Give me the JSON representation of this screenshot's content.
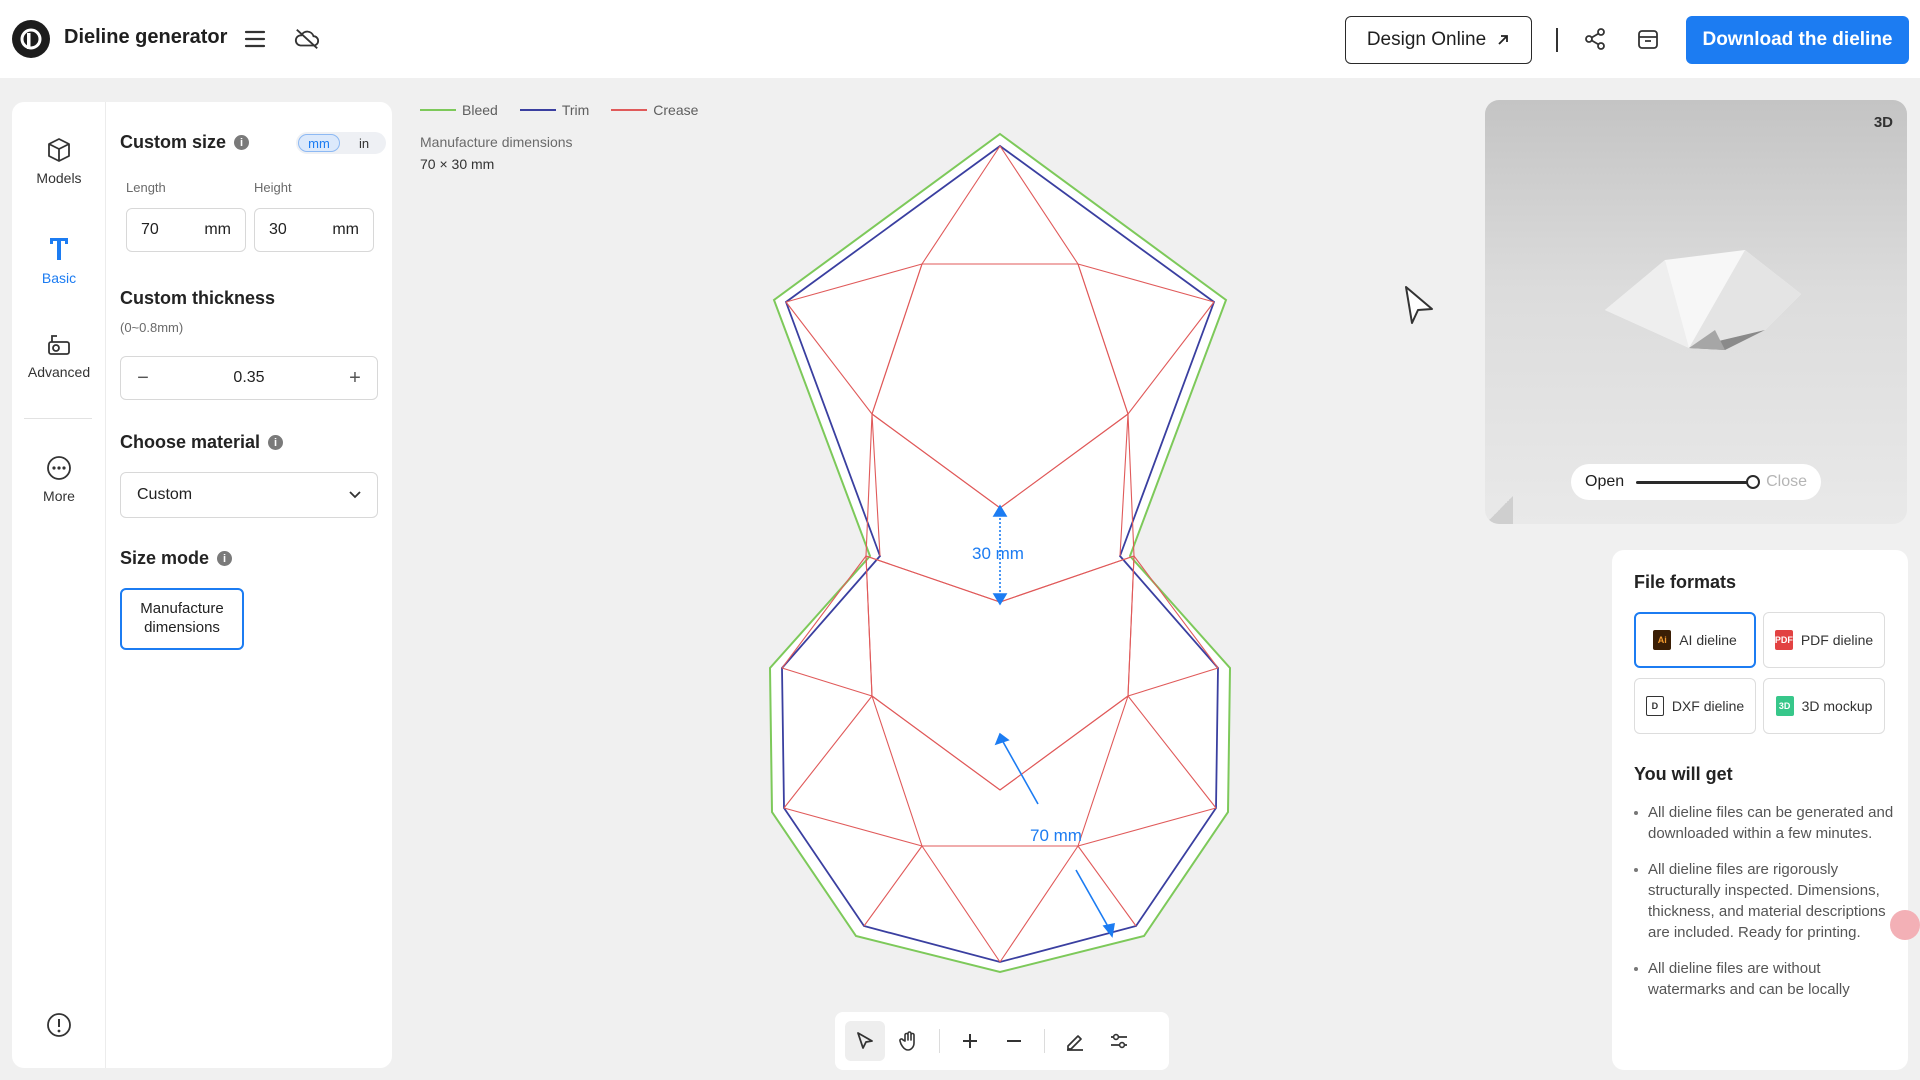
{
  "header": {
    "app_title": "Dieline generator",
    "icons": [
      "menu-icon",
      "cloud-off-icon",
      "share-icon",
      "archive-icon"
    ],
    "design_online_label": "Design Online",
    "download_label": "Download the dieline",
    "accent_color": "#1c7cf2"
  },
  "rail": {
    "items": [
      {
        "label": "Models",
        "icon": "cube-icon"
      },
      {
        "label": "Basic",
        "icon": "text-t-icon",
        "active": true
      },
      {
        "label": "Advanced",
        "icon": "advanced-icon"
      },
      {
        "label": "More",
        "icon": "more-icon"
      }
    ],
    "footer_icon": "info-circle-icon"
  },
  "form": {
    "custom_size_title": "Custom size",
    "units": [
      "mm",
      "in"
    ],
    "active_unit": "mm",
    "length_label": "Length",
    "height_label": "Height",
    "length_value": "70",
    "height_value": "30",
    "unit_suffix": "mm",
    "thickness_title": "Custom thickness",
    "thickness_range": "(0~0.8mm)",
    "thickness_value": "0.35",
    "material_title": "Choose material",
    "material_value": "Custom",
    "size_mode_title": "Size mode",
    "size_mode_value": "Manufacture dimensions"
  },
  "canvas": {
    "legend": [
      {
        "label": "Bleed",
        "color": "#7dc95a"
      },
      {
        "label": "Trim",
        "color": "#3a3fa0"
      },
      {
        "label": "Crease",
        "color": "#e05a5a"
      }
    ],
    "manufacture_label": "Manufacture dimensions",
    "manufacture_value": "70 × 30 mm",
    "height_dim_label": "30 mm",
    "length_dim_label": "70 mm"
  },
  "toolbar": {
    "tools": [
      "select-tool-icon",
      "hand-tool-icon",
      "zoom-in-icon",
      "zoom-out-icon",
      "pen-tool-icon",
      "adjust-icon"
    ]
  },
  "preview": {
    "toggle_label": "3D",
    "open_label": "Open",
    "close_label": "Close",
    "fold_level": 1.0
  },
  "formats": {
    "title": "File formats",
    "options": [
      {
        "label": "AI dieline",
        "icon": "ai-file-icon",
        "active": true
      },
      {
        "label": "PDF dieline",
        "icon": "pdf-file-icon"
      },
      {
        "label": "DXF dieline",
        "icon": "dxf-file-icon"
      },
      {
        "label": "3D mockup",
        "icon": "mockup-icon"
      }
    ],
    "you_will_get_title": "You will get",
    "benefits": [
      "All dieline files can be generated and downloaded within a few minutes.",
      "All dieline files are rigorously structurally inspected. Dimensions, thickness, and material descriptions are included. Ready for printing.",
      "All dieline files are without watermarks and can be locally"
    ]
  }
}
